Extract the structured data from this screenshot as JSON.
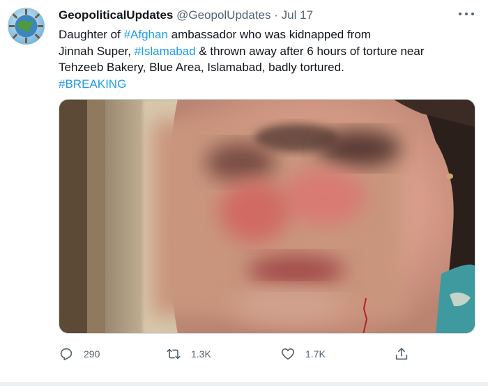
{
  "tweet": {
    "display_name": "GeopoliticalUpdates",
    "handle": "@GeopolUpdates",
    "separator": "·",
    "date": "Jul 17",
    "text": {
      "t1": "Daughter of ",
      "h1": "#Afghan",
      "t2": " ambassador who was kidnapped from",
      "t3": "Jinnah Super, ",
      "h2": "#Islamabad",
      "t4": " & thrown away after 6 hours of torture near",
      "t5": "Tehzeeb Bakery, Blue Area, Islamabad, badly tortured.",
      "h3": "#BREAKING"
    }
  },
  "actions": {
    "reply_count": "290",
    "retweet_count": "1.3K",
    "like_count": "1.7K"
  },
  "icons": {
    "reply": "reply-icon",
    "retweet": "retweet-icon",
    "like": "heart-icon",
    "share": "share-icon",
    "more": "more-icon"
  },
  "colors": {
    "hashtag": "#1d9bf0",
    "secondary_text": "#536471",
    "text": "#0f1419"
  }
}
